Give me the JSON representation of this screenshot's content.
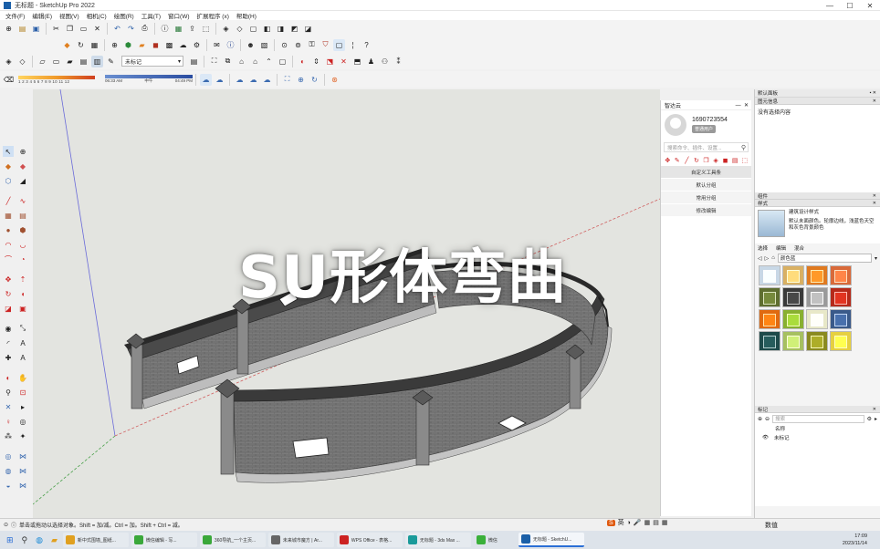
{
  "window": {
    "title": "无标题 - SketchUp Pro 2022",
    "controls": [
      "—",
      "☐",
      "✕"
    ]
  },
  "menu": [
    "文件(F)",
    "编辑(E)",
    "视图(V)",
    "相机(C)",
    "绘图(R)",
    "工具(T)",
    "窗口(W)",
    "扩展程序 (x)",
    "帮助(H)"
  ],
  "toolbar": {
    "tag_dropdown": "未标记",
    "shadow_scale": "1 2 3 4 5 6 7 8 9 10 11 12",
    "time_start": "06:33 AM",
    "time_mid": "中午",
    "time_end": "04:49 PM"
  },
  "overlay_caption": "SU形体弯曲",
  "cloud_panel": {
    "title": "智达云",
    "user_id": "1690723554",
    "user_badge": "普通用户",
    "search_placeholder": "搜索命令、插件、设置...",
    "menu": [
      "自定义工具条",
      "默认分组",
      "常用分组",
      "修改编辑"
    ]
  },
  "tray": {
    "title": "默认面板",
    "entity_info": {
      "header": "图元信息",
      "body": "没有选择内容"
    },
    "components_header": "组件",
    "styles_header": "样式",
    "style_name": "建筑设计样式",
    "style_desc": "默认未面颜色。轮廓边线，浅蓝色天空和灰色背景颜色",
    "materials_tabs": [
      "选择",
      "编辑",
      "混合"
    ],
    "materials_dropdown": "颜色蓝",
    "tags_header": "标记",
    "tags_search": "搜索",
    "tags_col": "名称",
    "tag_item": "未标记",
    "bottom_label": "数值"
  },
  "materials": [
    "#c8d8e6",
    "#d9b063",
    "#e07a20",
    "#d96a3a",
    "#5e6e30",
    "#3a3a3a",
    "#9a9a9a",
    "#b52a1a",
    "#e06a10",
    "#88b030",
    "#e8e8c8",
    "#3a5a8a",
    "#1e4a4a",
    "#a6c060",
    "#8a8a20",
    "#e6d040"
  ],
  "status": {
    "text": "单击或拖动以选择对象。Shift = 加/减。Ctrl = 加。Shift + Ctrl = 减。"
  },
  "taskbar": {
    "apps": [
      "新中式围墙_图纸...",
      "微信编辑 - 写...",
      "360导航_一个主页...",
      "未来城市魔方 | Ar...",
      "WPS Office - 表格...",
      "无标题 - 3ds Max ...",
      "微信",
      "无标题 - SketchU..."
    ],
    "time": "17:09",
    "date": "2023/11/14"
  }
}
